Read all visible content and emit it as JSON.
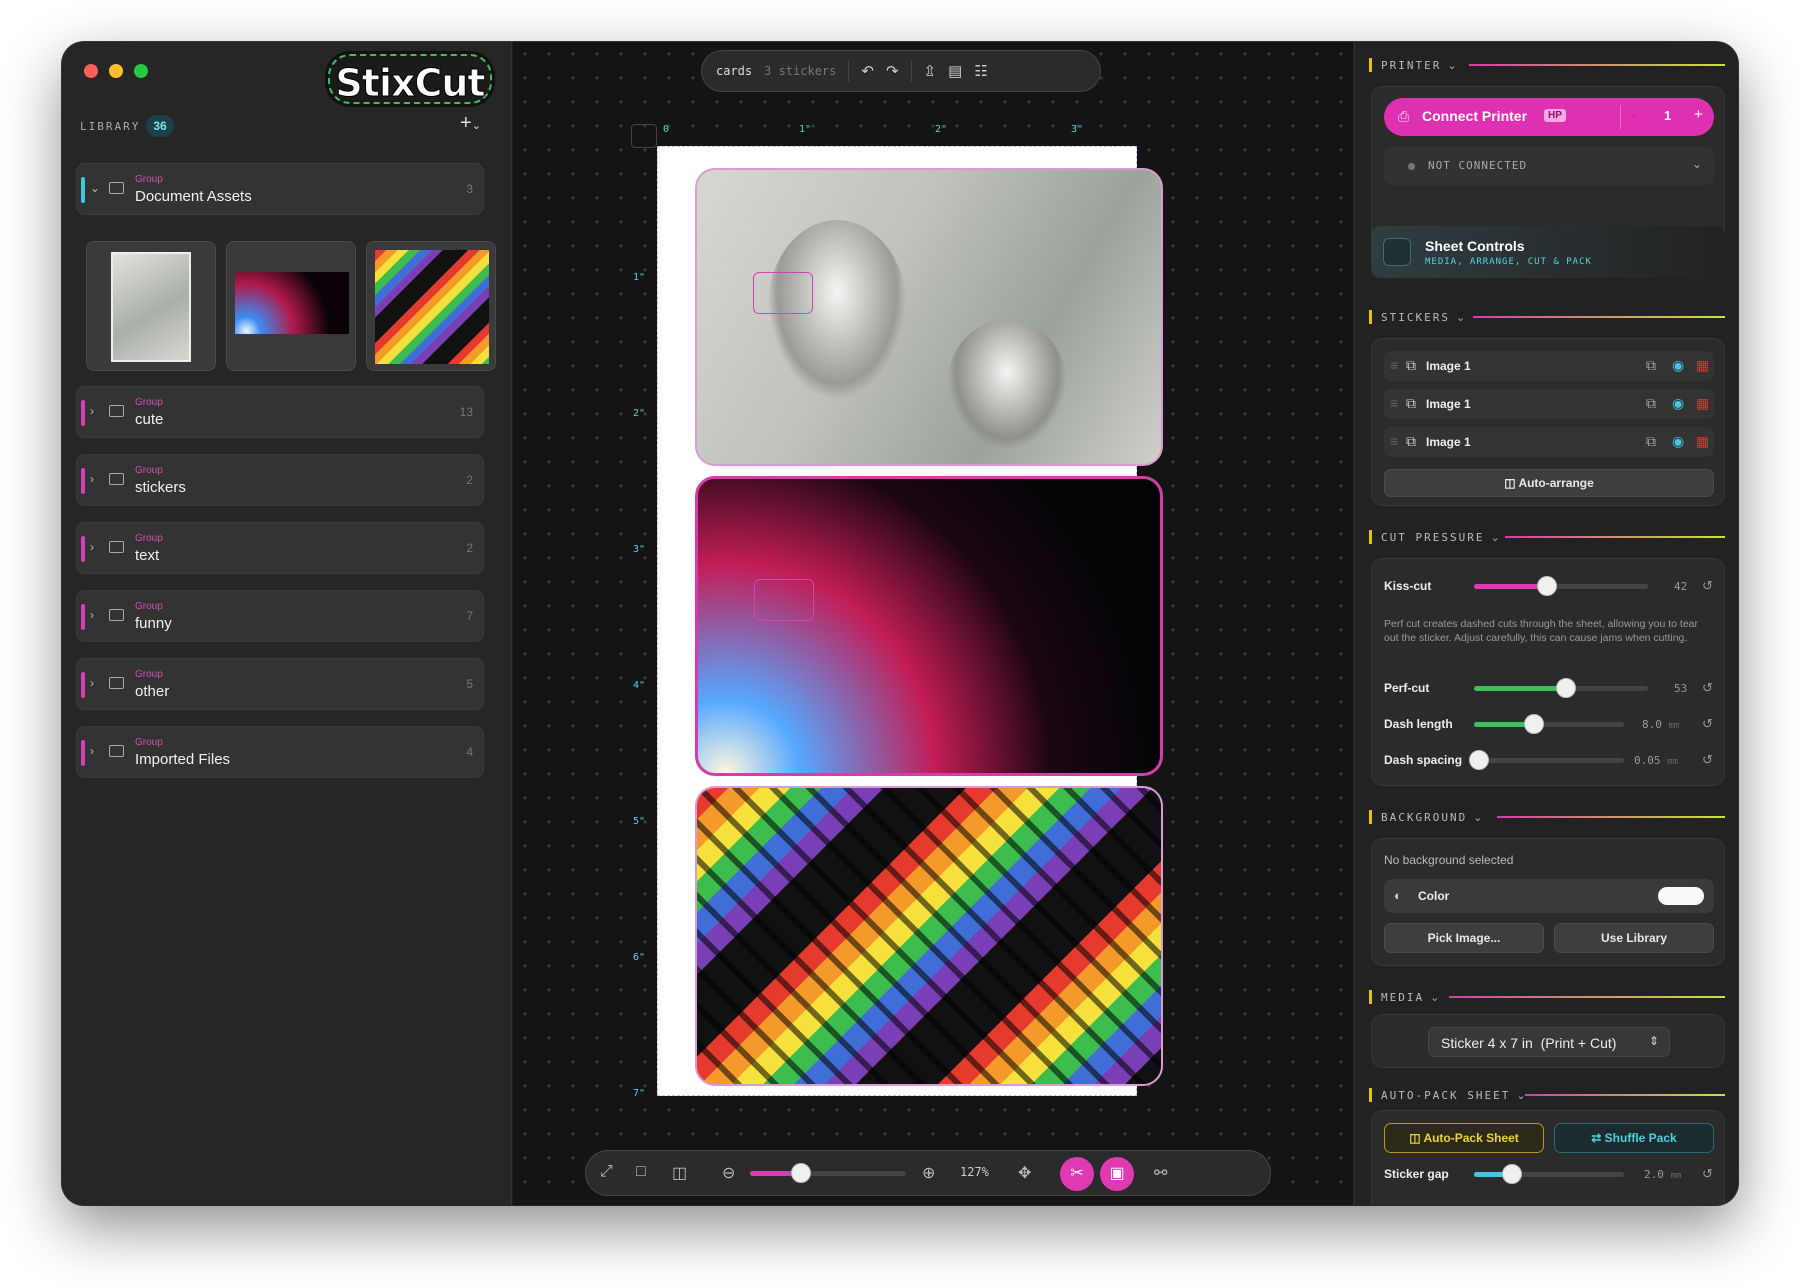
{
  "app": {
    "name": "StixCut"
  },
  "library": {
    "label": "LIBRARY",
    "count": "36",
    "add_label": "+",
    "groups": [
      {
        "kind": "Group",
        "name": "Document Assets",
        "count": "3",
        "expanded": true
      },
      {
        "kind": "Group",
        "name": "cute",
        "count": "13"
      },
      {
        "kind": "Group",
        "name": "stickers",
        "count": "2"
      },
      {
        "kind": "Group",
        "name": "text",
        "count": "2"
      },
      {
        "kind": "Group",
        "name": "funny",
        "count": "7"
      },
      {
        "kind": "Group",
        "name": "other",
        "count": "5"
      },
      {
        "kind": "Group",
        "name": "Imported Files",
        "count": "4"
      }
    ]
  },
  "toolbar": {
    "doc_name": "cards",
    "sticker_count": "3 stickers"
  },
  "ruler": {
    "top": [
      "0",
      "1\"",
      "2\"",
      "3\""
    ],
    "left": [
      "1\"",
      "2\"",
      "3\"",
      "4\"",
      "5\"",
      "6\"",
      "7\""
    ]
  },
  "zoom": {
    "level_text": "127%",
    "slider_fraction": 0.33
  },
  "printer": {
    "section": "PRINTER",
    "connect_label": "Connect Printer",
    "badge": "HP",
    "copies": "1",
    "minus": "−",
    "plus": "+",
    "status": "NOT CONNECTED"
  },
  "sheet_controls": {
    "title": "Sheet Controls",
    "subtitle": "MEDIA, ARRANGE, CUT & PACK"
  },
  "stickers": {
    "section": "STICKERS",
    "items": [
      {
        "name": "Image 1"
      },
      {
        "name": "Image 1"
      },
      {
        "name": "Image 1"
      }
    ],
    "auto_arrange": "Auto-arrange"
  },
  "cut_pressure": {
    "section": "CUT PRESSURE",
    "kiss_label": "Kiss-cut",
    "kiss_value": "42",
    "kiss_fraction": 0.42,
    "help": "Perf cut creates dashed cuts through the sheet, allowing you to tear out the sticker. Adjust carefully, this can cause jams when cutting.",
    "perf_label": "Perf-cut",
    "perf_value": "53",
    "perf_fraction": 0.53,
    "dash_len_label": "Dash length",
    "dash_len_value": "8.0",
    "dash_len_unit": "mm",
    "dash_len_fraction": 0.4,
    "dash_sp_label": "Dash spacing",
    "dash_sp_value": "0.05",
    "dash_sp_unit": "mm",
    "dash_sp_fraction": 0.03
  },
  "background": {
    "section": "BACKGROUND",
    "none_text": "No background selected",
    "color_label": "Color",
    "pick_image": "Pick Image...",
    "use_library": "Use Library"
  },
  "media": {
    "section": "MEDIA",
    "selected": "Sticker 4 x 7 in  (Print + Cut)"
  },
  "auto_pack": {
    "section": "AUTO-PACK SHEET",
    "auto_pack_label": "Auto-Pack Sheet",
    "shuffle_label": "Shuffle Pack",
    "gap_label": "Sticker gap",
    "gap_value": "2.0",
    "gap_unit": "mm",
    "gap_fraction": 0.25
  },
  "colors": {
    "accent": "#e03ab2",
    "cyan": "#57d3e3",
    "yellow": "#e8c400",
    "green": "#3fbf5a"
  }
}
